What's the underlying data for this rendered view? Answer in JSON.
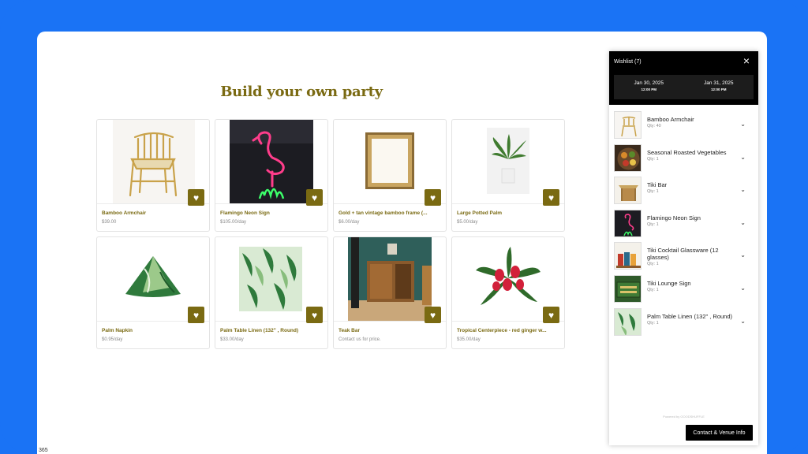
{
  "page": {
    "title": "Build your own party"
  },
  "products": [
    {
      "name": "Bamboo Armchair",
      "price": "$39.00"
    },
    {
      "name": "Flamingo Neon Sign",
      "price": "$105.00/day"
    },
    {
      "name": "Gold + tan vintage bamboo frame (...",
      "price": "$6.00/day"
    },
    {
      "name": "Large Potted Palm",
      "price": "$5.00/day"
    },
    {
      "name": "Palm Napkin",
      "price": "$0.95/day"
    },
    {
      "name": "Palm Table Linen (132\" , Round)",
      "price": "$33.00/day"
    },
    {
      "name": "Teak Bar",
      "price": "Contact us for price."
    },
    {
      "name": "Tropical Centerpiece - red ginger w...",
      "price": "$35.00/day"
    }
  ],
  "wishlist": {
    "title": "Wishlist (7)",
    "start_date": "Jan 30, 2025",
    "start_time": "12:00 PM",
    "end_date": "Jan 31, 2025",
    "end_time": "12:00 PM",
    "items": [
      {
        "name": "Bamboo Armchair",
        "qty": "Qty: 40"
      },
      {
        "name": "Seasonal Roasted Vegetables",
        "qty": "Qty: 1"
      },
      {
        "name": "Tiki Bar",
        "qty": "Qty: 1"
      },
      {
        "name": "Flamingo Neon Sign",
        "qty": "Qty: 1"
      },
      {
        "name": "Tiki Cocktail Glassware (12 glasses)",
        "qty": "Qty: 1"
      },
      {
        "name": "Tiki Lounge Sign",
        "qty": "Qty: 1"
      },
      {
        "name": "Palm Table Linen (132\" , Round)",
        "qty": "Qty: 1"
      }
    ],
    "powered_by": "Powered by GOODSHUFFLE",
    "contact_label": "Contact & Venue Info"
  },
  "corner_text": "365",
  "colors": {
    "accent": "#7a6a12",
    "frame": "#1a73f5",
    "panel_header": "#000000"
  }
}
